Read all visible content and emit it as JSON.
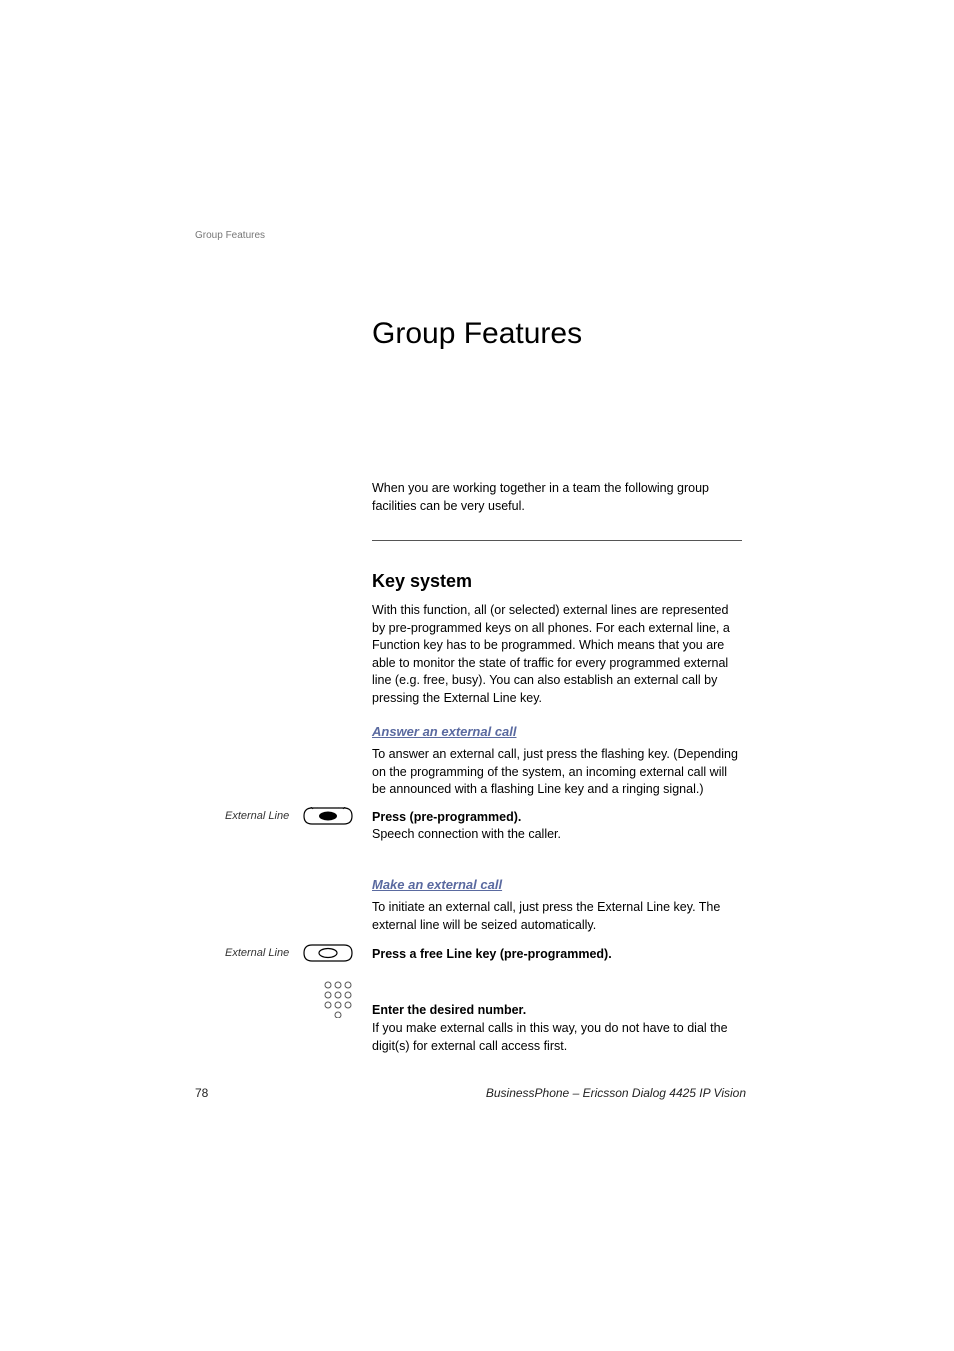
{
  "header": {
    "running": "Group Features"
  },
  "title": "Group Features",
  "intro": "When you are working together in a team the following group facilities can be very useful.",
  "section": {
    "heading": "Key system",
    "body": "With this function, all (or selected) external lines are represented by pre-programmed keys on all phones. For each external line, a Function key has to be programmed. Which means that you are able to monitor the state of traffic for every programmed external line (e.g. free, busy). You can also establish an external call by pressing the External Line key."
  },
  "sub1": {
    "heading": "Answer an external call",
    "body": "To answer an external call, just press the flashing key. (Depending on the programming of the system, an incoming external call will be announced with a flashing Line key and a ringing signal.)",
    "key_label": "External Line",
    "press_bold": "Press (pre-programmed).",
    "press_body": "Speech connection with the caller."
  },
  "sub2": {
    "heading": "Make an external call",
    "body": "To initiate an external call, just press the External Line key. The external line will be seized automatically.",
    "key_label": "External Line",
    "press_bold": "Press a free Line key (pre-programmed).",
    "enter_bold": "Enter the desired number.",
    "enter_body": "If you make external calls in this way, you do not have to dial the digit(s) for external call access first."
  },
  "footer": {
    "page": "78",
    "right": "BusinessPhone – Ericsson Dialog 4425 IP Vision"
  }
}
